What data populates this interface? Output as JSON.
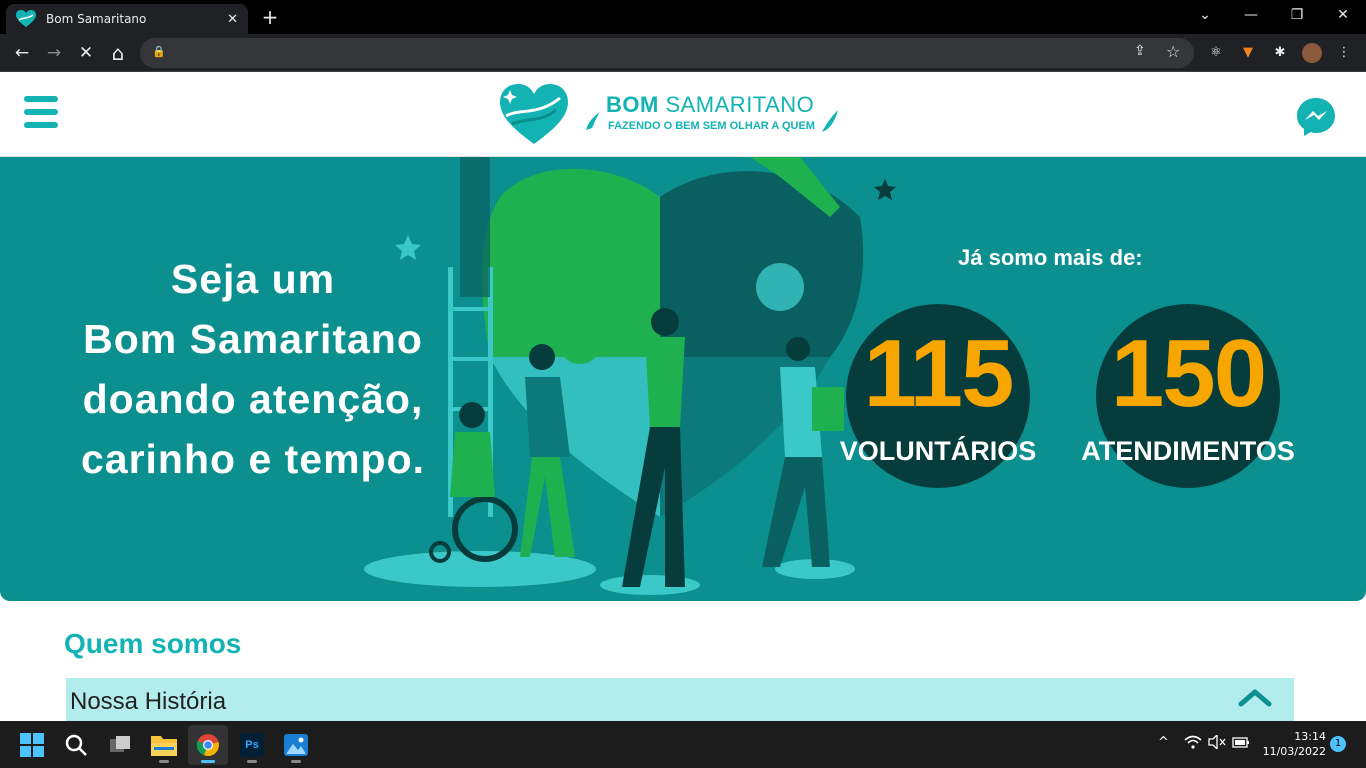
{
  "browser": {
    "tab_title": "Bom Samaritano",
    "tab_close": "✕",
    "new_tab": "+",
    "window_controls": {
      "minimize": "—",
      "restore": "❐",
      "close": "✕",
      "dropdown": "⌄"
    },
    "nav": {
      "back": "←",
      "forward": "→",
      "stop": "✕",
      "home": "⌂"
    },
    "omnibox_value": "",
    "toolbar_icons": [
      "share-icon",
      "star-icon",
      "react-devtools-icon",
      "metamask-icon",
      "extensions-icon",
      "profile-avatar",
      "menu-dots-icon"
    ]
  },
  "header": {
    "brand_bold": "BOM",
    "brand_light": "SAMARITANO",
    "tagline": "FAZENDO O BEM SEM OLHAR A QUEM",
    "brand_color": "#13b3b3"
  },
  "hero": {
    "line1": "Seja um",
    "line2": "Bom Samaritano",
    "line3": "doando atenção,",
    "line4": "carinho e tempo.",
    "stats_heading": "Já somo mais de:",
    "stats": [
      {
        "value": "115",
        "label": "VOLUNTÁRIOS"
      },
      {
        "value": "150",
        "label": "ATENDIMENTOS"
      }
    ],
    "background_color": "#0b8f8f",
    "number_color": "#f7a600"
  },
  "section": {
    "title": "Quem somos",
    "accordion_title": "Nossa História"
  },
  "taskbar": {
    "time": "13:14",
    "date": "11/03/2022",
    "notifications": "1",
    "apps": [
      "windows-start",
      "search",
      "task-view",
      "file-explorer",
      "chrome",
      "photoshop",
      "photos"
    ]
  }
}
